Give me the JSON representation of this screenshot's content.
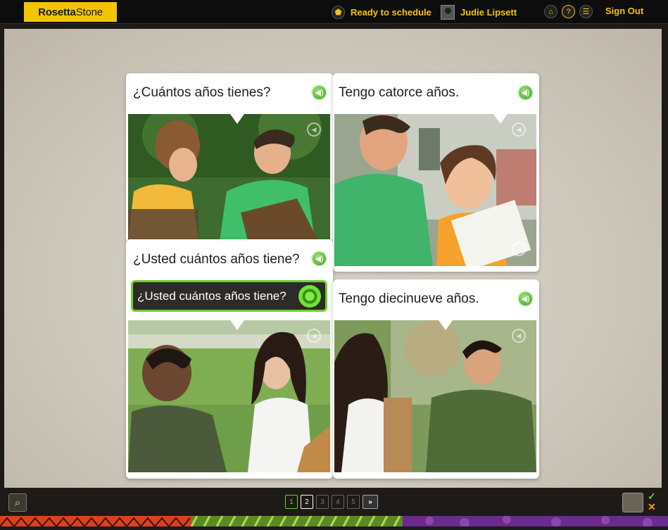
{
  "header": {
    "logo_rosetta": "Rosetta",
    "logo_stone": "Stone",
    "schedule_label": "Ready to schedule",
    "user_name": "Judie Lipsett",
    "sign_out": "Sign Out"
  },
  "panels": [
    {
      "caption": "¿Cuántos años tienes?"
    },
    {
      "caption": "Tengo catorce años."
    },
    {
      "caption": "¿Usted cuántos años tiene?"
    },
    {
      "caption": "Tengo diecinueve años."
    }
  ],
  "response": {
    "text": "¿Usted cuántos años tiene?"
  },
  "pagination": {
    "pages": [
      "1",
      "2",
      "3",
      "4",
      "5"
    ],
    "next": "»"
  },
  "colors": {
    "brand": "#f2c500",
    "accent_green": "#6fcf2f"
  }
}
